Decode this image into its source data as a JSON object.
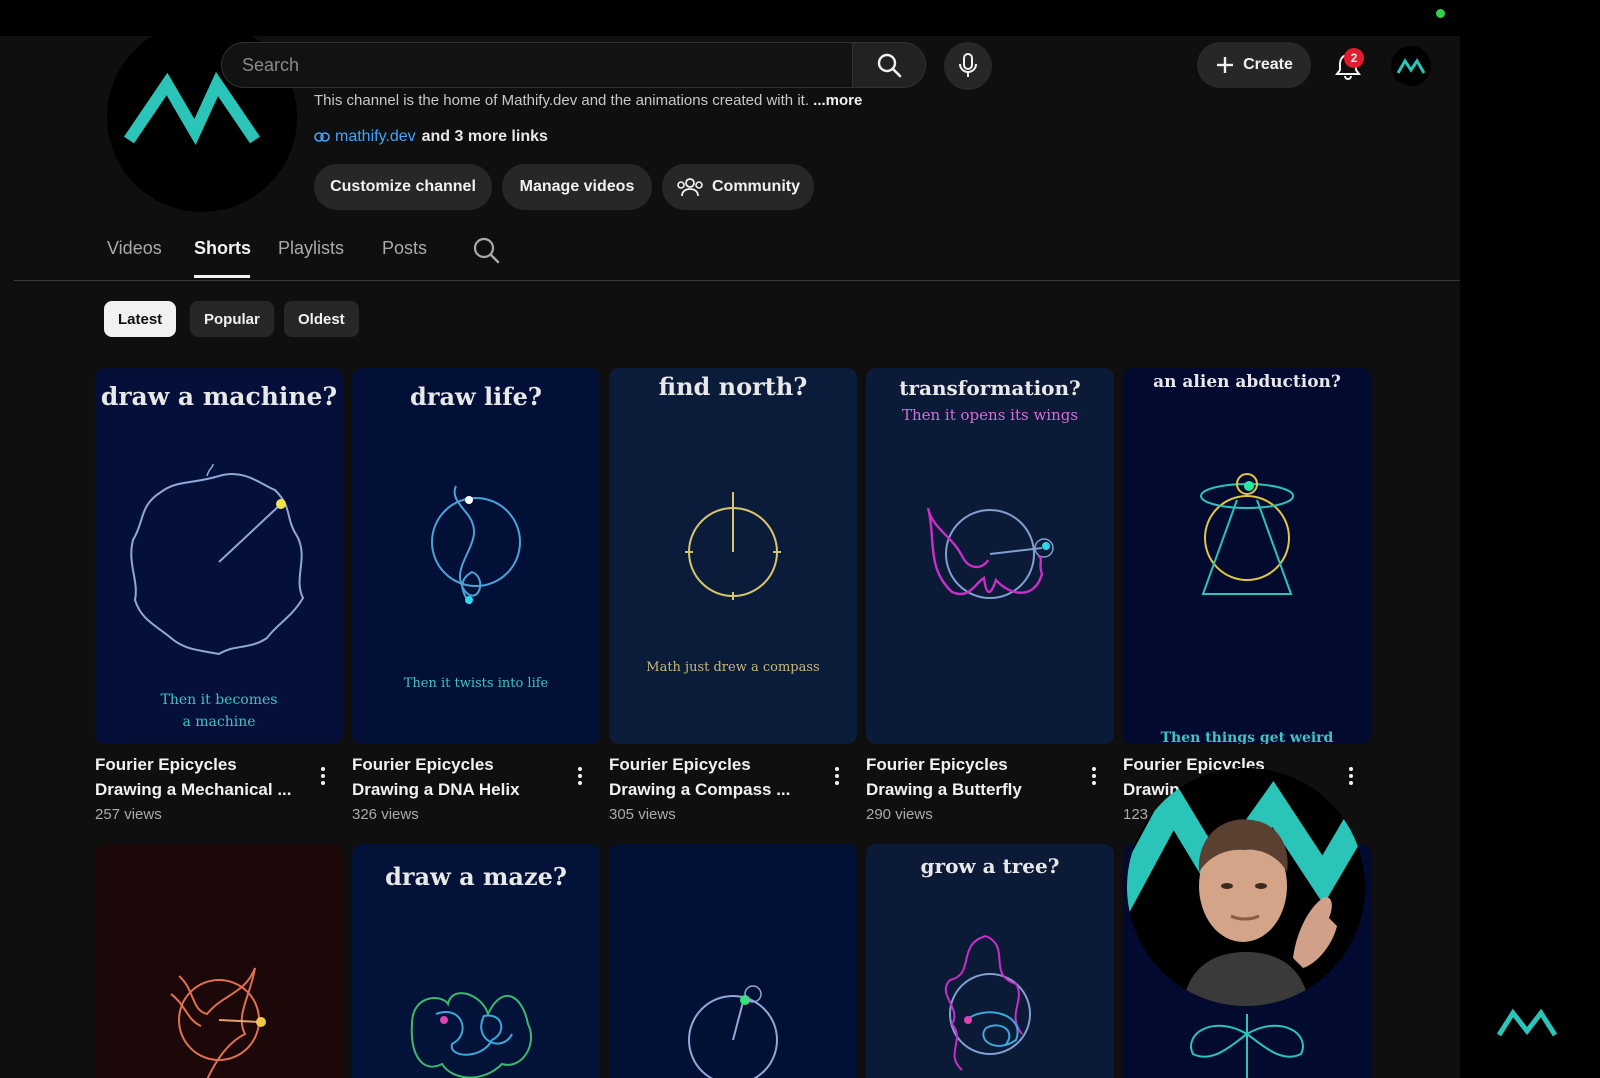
{
  "header": {
    "search_placeholder": "Search",
    "create_label": "Create",
    "notification_count": "2"
  },
  "channel": {
    "description": "This channel is the home of Mathify.dev and the animations created with it.",
    "description_more": "...more",
    "link": "mathify.dev",
    "more_links": "and 3 more links",
    "buttons": {
      "customize": "Customize channel",
      "manage": "Manage videos",
      "community": "Community"
    }
  },
  "tabs": [
    "Videos",
    "Shorts",
    "Playlists",
    "Posts"
  ],
  "active_tab": "Shorts",
  "chips": [
    "Latest",
    "Popular",
    "Oldest"
  ],
  "active_chip": "Latest",
  "shorts_row1": [
    {
      "thumb_title": "draw a machine?",
      "thumb_caption_1": "Then it becomes",
      "thumb_caption_2": "a machine",
      "title_line1": "Fourier Epicycles",
      "title_line2": "Drawing a Mechanical ...",
      "views": "257 views"
    },
    {
      "thumb_title": "draw life?",
      "thumb_caption_1": "Then it twists into life",
      "title_line1": "Fourier Epicycles",
      "title_line2": "Drawing a DNA Helix",
      "views": "326 views"
    },
    {
      "thumb_title": "find north?",
      "thumb_caption_1": "Math just drew a compass",
      "title_line1": "Fourier Epicycles",
      "title_line2": "Drawing a Compass ...",
      "views": "305 views"
    },
    {
      "thumb_title": "transformation?",
      "thumb_subtitle": "Then it opens its wings",
      "title_line1": "Fourier Epicycles",
      "title_line2": "Drawing a Butterfly",
      "views": "290 views"
    },
    {
      "thumb_title": "an alien abduction?",
      "thumb_caption_1": "Then things get weird",
      "title_line1": "Fourier Epicycles",
      "title_line2": "Drawin",
      "views": "123"
    }
  ],
  "shorts_row2": [
    {
      "thumb_title": ""
    },
    {
      "thumb_title": "draw a maze?"
    },
    {
      "thumb_title": ""
    },
    {
      "thumb_title": "grow a tree?"
    },
    {
      "thumb_title": ""
    }
  ],
  "colors": {
    "accent_teal": "#2bc4b8",
    "link_blue": "#3ea6ff",
    "badge_red": "#e21d2f"
  }
}
